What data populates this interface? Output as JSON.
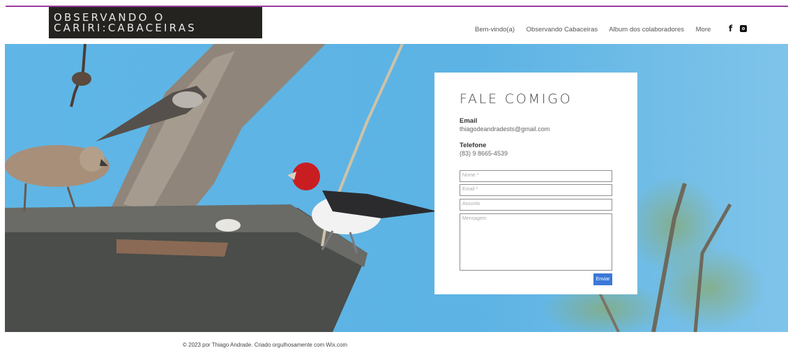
{
  "header": {
    "logo_line1": "OBSERVANDO O",
    "logo_line2": "CARIRI:CABACEIRAS",
    "nav": [
      "Bem-vindo(a)",
      "Observando Cabaceiras",
      "Album dos colaboradores",
      "More"
    ],
    "social_icons": [
      "facebook-icon",
      "instagram-icon"
    ],
    "accent_color": "#9b3aa0"
  },
  "contact": {
    "title": "FALE COMIGO",
    "email_label": "Email",
    "email_value": "thiagodeandradests@gmail.com",
    "phone_label": "Telefone",
    "phone_value": "(83) 9 8665-4539",
    "name_placeholder": "Nome *",
    "email_placeholder": "Email *",
    "subject_placeholder": "Assunto",
    "message_placeholder": "Mensagem",
    "submit_label": "Enviar",
    "button_color": "#3a78d8"
  },
  "footer": {
    "text": "© 2023 por Thiago Andrade. Criado orgulhosamente com Wix.com"
  }
}
